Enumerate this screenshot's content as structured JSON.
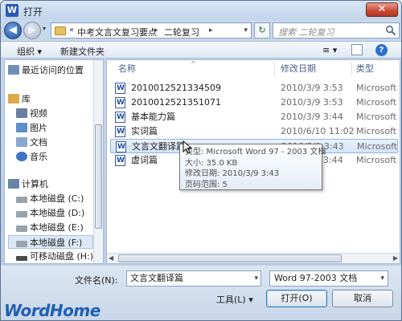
{
  "window": {
    "title": "打开",
    "app_icon": "W",
    "close_label": "✕"
  },
  "address": {
    "back_glyph": "◀",
    "forward_glyph": "▶",
    "history_glyph": "▾",
    "crumbs": [
      "中考文言文复习要点",
      "二轮复习"
    ],
    "crumb_chevron": "«",
    "crumb_sep": "▸",
    "crumb_drop": "▾",
    "refresh_glyph": "↻",
    "search_placeholder": "搜索 二轮复习"
  },
  "toolbar": {
    "organize": "组织 ▾",
    "new_folder": "新建文件夹",
    "views": "≡ ▾",
    "help": "?"
  },
  "nav": {
    "items": [
      {
        "label": "最近访问的位置",
        "icon": "recent-places-icon",
        "color": "#6f8fb8"
      },
      {
        "label": "库",
        "icon": "library-icon",
        "color": "#d9a94a"
      },
      {
        "label": "视频",
        "icon": "video-icon",
        "color": "#6b7fa0"
      },
      {
        "label": "图片",
        "icon": "pictures-icon",
        "color": "#5d8fc9"
      },
      {
        "label": "文档",
        "icon": "documents-icon",
        "color": "#8aa8cf"
      },
      {
        "label": "音乐",
        "icon": "music-icon",
        "color": "#3f74c8"
      },
      {
        "label": "计算机",
        "icon": "computer-icon",
        "color": "#6883a8"
      },
      {
        "label": "本地磁盘 (C:)",
        "icon": "drive-icon",
        "color": "#9aa3ad"
      },
      {
        "label": "本地磁盘 (D:)",
        "icon": "drive-icon",
        "color": "#9aa3ad"
      },
      {
        "label": "本地磁盘 (E:)",
        "icon": "drive-icon",
        "color": "#9aa3ad"
      },
      {
        "label": "本地磁盘 (F:)",
        "icon": "drive-icon",
        "color": "#9aa3ad"
      },
      {
        "label": "可移动磁盘 (H:)",
        "icon": "removable-drive-icon",
        "color": "#4a4a4a"
      }
    ]
  },
  "files": {
    "columns": {
      "name": "名称",
      "date": "修改日期",
      "type": "类型",
      "sort_glyph": "^"
    },
    "rows": [
      {
        "name": "2010012521334509",
        "date": "2010/3/9 3:53",
        "type": "Microsoft W",
        "icon": "doc"
      },
      {
        "name": "2010012521351071",
        "date": "2010/3/9 3:53",
        "type": "Microsoft W",
        "icon": "doc"
      },
      {
        "name": "基本能力篇",
        "date": "2010/3/9 3:44",
        "type": "Microsoft W",
        "icon": "doc"
      },
      {
        "name": "实词篇",
        "date": "2010/6/10 11:02",
        "type": "Microsoft W",
        "icon": "doc"
      },
      {
        "name": "文言文翻译篇",
        "date": "2010/3/9 3:43",
        "type": "Microsoft W",
        "icon": "doc"
      },
      {
        "name": "虚词篇",
        "date": "2010/3/9 3:44",
        "type": "Microsoft W",
        "icon": "doc"
      }
    ],
    "scroll_left": "◀",
    "scroll_right": "▶"
  },
  "tooltip": {
    "type_line": "类型: Microsoft Word 97 - 2003 文档",
    "size_line": "大小: 35.0 KB",
    "date_line": "修改日期: 2010/3/9 3:43",
    "pages_line": "页码范围: 5"
  },
  "bottom": {
    "filename_label": "文件名(N):",
    "filename_value": "文言文翻译篇",
    "filetype_value": "Word 97-2003 文档",
    "dropdown_glyph": "▾",
    "tools": "工具(L) ▾",
    "open": "打开(O)",
    "cancel": "取消"
  },
  "watermark": "WordHome"
}
